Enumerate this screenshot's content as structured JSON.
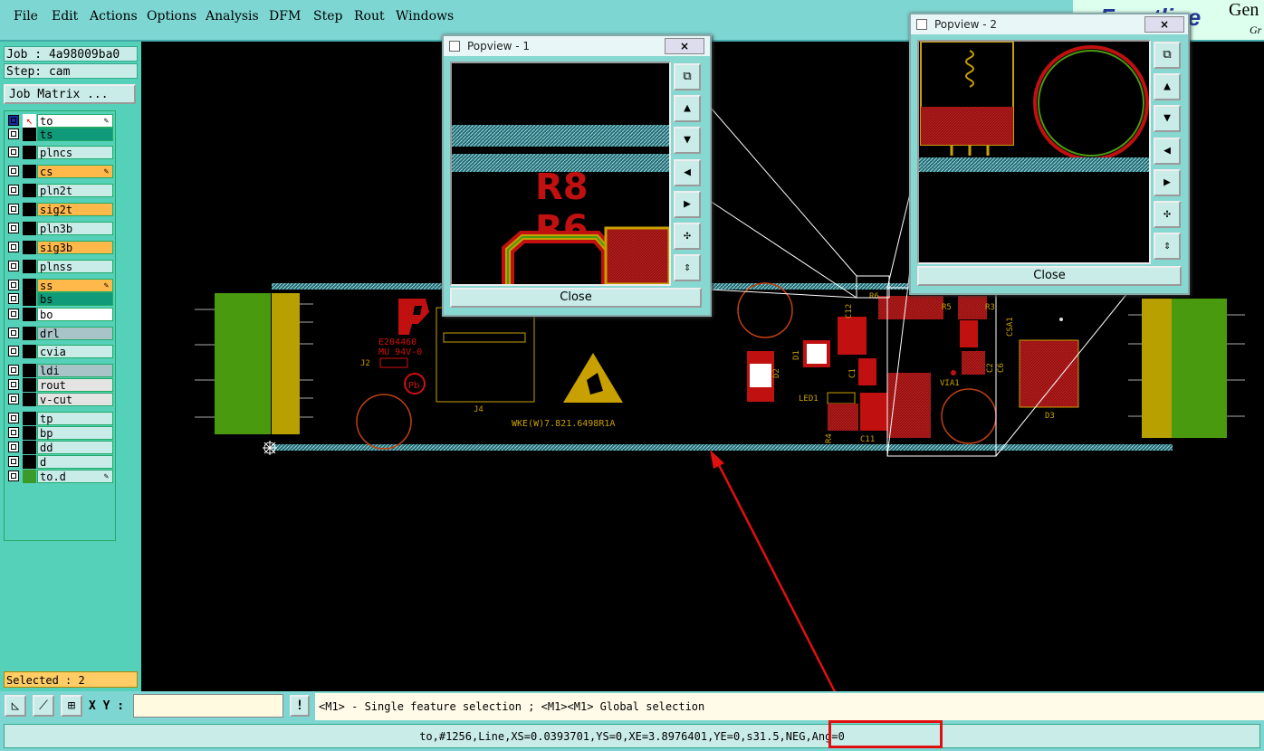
{
  "menu": {
    "items": [
      "File",
      "Edit",
      "Actions",
      "Options",
      "Analysis",
      "DFM",
      "Step",
      "Rout",
      "Windows"
    ],
    "brand": {
      "part1": "Frontline",
      "part2": "Gen",
      "part3": "Gr"
    }
  },
  "left": {
    "job": "Job : 4a98009ba0",
    "step": "Step: cam",
    "job_matrix": "Job Matrix ...",
    "selected": "Selected : 2",
    "layers": [
      {
        "name": "to",
        "color": "#000000",
        "bg": "#ffffff",
        "affected": true
      },
      {
        "name": "ts",
        "color": "#000000",
        "bg": "#0f9a7a",
        "affected": false
      },
      {
        "name": "plncs",
        "color": "#000000",
        "bg": "#c9ece9",
        "affected": false
      },
      {
        "name": "cs",
        "color": "#000000",
        "bg": "#ffb84a",
        "affected": true
      },
      {
        "name": "pln2t",
        "color": "#000000",
        "bg": "#c9ece9",
        "affected": false
      },
      {
        "name": "sig2t",
        "color": "#000000",
        "bg": "#ffb84a",
        "affected": false
      },
      {
        "name": "pln3b",
        "color": "#000000",
        "bg": "#c9ece9",
        "affected": false
      },
      {
        "name": "sig3b",
        "color": "#000000",
        "bg": "#ffb84a",
        "affected": false
      },
      {
        "name": "plnss",
        "color": "#000000",
        "bg": "#c9ece9",
        "affected": false
      },
      {
        "name": "ss",
        "color": "#000000",
        "bg": "#ffb84a",
        "affected": true
      },
      {
        "name": "bs",
        "color": "#000000",
        "bg": "#0f9a7a",
        "affected": false
      },
      {
        "name": "bo",
        "color": "#000000",
        "bg": "#ffffff",
        "affected": false
      },
      {
        "name": "drl",
        "color": "#000000",
        "bg": "#a8c4c8",
        "affected": false
      },
      {
        "name": "cvia",
        "color": "#000000",
        "bg": "#c9ece9",
        "affected": false
      },
      {
        "name": "ldi",
        "color": "#000000",
        "bg": "#a8c4c8",
        "affected": false
      },
      {
        "name": "rout",
        "color": "#000000",
        "bg": "#e4e4e4",
        "affected": false
      },
      {
        "name": "v-cut",
        "color": "#000000",
        "bg": "#e4e4e4",
        "affected": false
      },
      {
        "name": "tp",
        "color": "#000000",
        "bg": "#c9ece9",
        "affected": false
      },
      {
        "name": "bp",
        "color": "#000000",
        "bg": "#c9ece9",
        "affected": false
      },
      {
        "name": "dd",
        "color": "#000000",
        "bg": "#c9ece9",
        "affected": false
      },
      {
        "name": "d",
        "color": "#000000",
        "bg": "#c9ece9",
        "affected": false
      },
      {
        "name": "to.d",
        "color": "#3a9a2a",
        "bg": "#c9ece9",
        "affected": true
      }
    ]
  },
  "bottom": {
    "xy_label": "X Y :",
    "xy_value": "",
    "excl": "!",
    "hint": "<M1> - Single feature selection ; <M1><M1> Global selection"
  },
  "status": {
    "text": "to,#1256,Line,XS=0.0393701,YS=0,XE=3.8976401,YE=0,s31.5,NEG,Ang=0"
  },
  "popview1": {
    "title": "Popview - 1",
    "close": "Close",
    "x": "×"
  },
  "popview2": {
    "title": "Popview - 2",
    "close": "Close",
    "x": "×"
  },
  "pcb": {
    "labels": {
      "e": "E204460",
      "ul": "MU 94V-0",
      "j2": "J2",
      "j4": "J4",
      "pb": "Pb",
      "code": "WKE(W)7.821.6498R1A",
      "d2": "D2",
      "d1": "D1",
      "d3": "D3",
      "led": "LED1",
      "c1": "C1",
      "r3": "R3",
      "r5": "R5",
      "via": "VIA1",
      "csa": "CSA1",
      "c11": "C11",
      "c12": "C12",
      "r6": "R6",
      "c6": "C6",
      "c2": "C2",
      "r4": "R4"
    },
    "pop1_labels": {
      "r8": "R8",
      "r6": "R6"
    }
  },
  "colors": {
    "pcb_red": "#c01010",
    "pcb_yellow": "#c8a000",
    "pcb_green": "#4a9a10",
    "hatch": "#5ab0b8",
    "annotation": "#e01010"
  }
}
